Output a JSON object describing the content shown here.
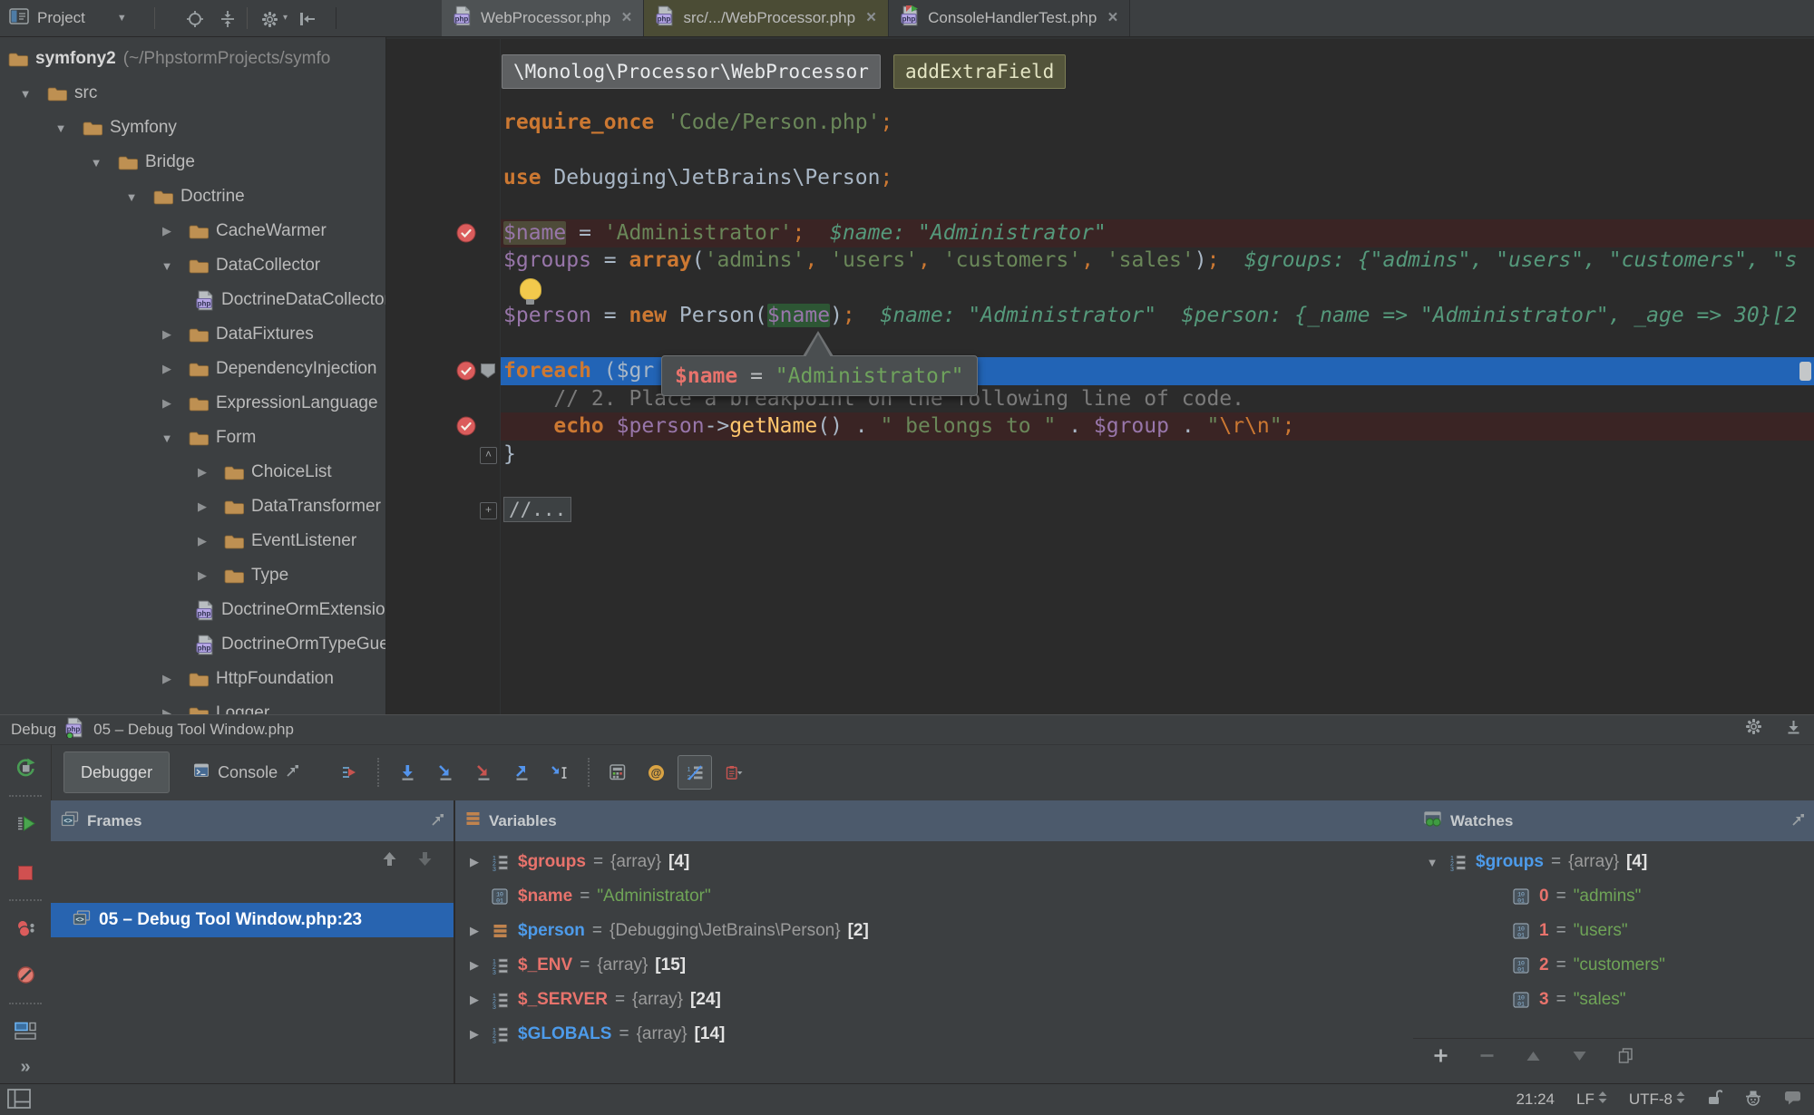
{
  "topbar": {
    "project_button": {
      "label": "Project"
    },
    "icons": [
      "scroll-from-source",
      "collapse-all",
      "settings",
      "hide-panel"
    ],
    "tabs": [
      {
        "label": "WebProcessor.php",
        "icon": "php-file",
        "state": "selected"
      },
      {
        "label": "src/.../WebProcessor.php",
        "icon": "php-file",
        "state": "library"
      },
      {
        "label": "ConsoleHandlerTest.php",
        "icon": "php-test-file",
        "state": "normal"
      }
    ]
  },
  "project_tree": {
    "root": {
      "name": "symfony2",
      "path": "(~/PhpstormProjects/symfo"
    },
    "items": [
      {
        "label": "src",
        "depth": 1,
        "type": "folder",
        "state": "expanded"
      },
      {
        "label": "Symfony",
        "depth": 2,
        "type": "folder",
        "state": "expanded"
      },
      {
        "label": "Bridge",
        "depth": 3,
        "type": "folder",
        "state": "expanded"
      },
      {
        "label": "Doctrine",
        "depth": 4,
        "type": "folder",
        "state": "expanded"
      },
      {
        "label": "CacheWarmer",
        "depth": 5,
        "type": "folder",
        "state": "collapsed"
      },
      {
        "label": "DataCollector",
        "depth": 5,
        "type": "folder",
        "state": "expanded"
      },
      {
        "label": "DoctrineDataCollector.php",
        "depth": 6,
        "type": "php-file"
      },
      {
        "label": "DataFixtures",
        "depth": 5,
        "type": "folder",
        "state": "collapsed"
      },
      {
        "label": "DependencyInjection",
        "depth": 5,
        "type": "folder",
        "state": "collapsed"
      },
      {
        "label": "ExpressionLanguage",
        "depth": 5,
        "type": "folder",
        "state": "collapsed"
      },
      {
        "label": "Form",
        "depth": 5,
        "type": "folder",
        "state": "expanded"
      },
      {
        "label": "ChoiceList",
        "depth": 6,
        "type": "folder",
        "state": "collapsed"
      },
      {
        "label": "DataTransformer",
        "depth": 6,
        "type": "folder",
        "state": "collapsed"
      },
      {
        "label": "EventListener",
        "depth": 6,
        "type": "folder",
        "state": "collapsed"
      },
      {
        "label": "Type",
        "depth": 6,
        "type": "folder",
        "state": "collapsed"
      },
      {
        "label": "DoctrineOrmExtension.php",
        "depth": 6,
        "type": "php-file"
      },
      {
        "label": "DoctrineOrmTypeGuesser.php",
        "depth": 6,
        "type": "php-file"
      },
      {
        "label": "HttpFoundation",
        "depth": 5,
        "type": "folder",
        "state": "collapsed"
      },
      {
        "label": "Logger",
        "depth": 5,
        "type": "folder",
        "state": "collapsed"
      }
    ]
  },
  "editor": {
    "breadcrumbs": [
      {
        "text": "\\Monolog\\Processor\\WebProcessor",
        "style": "class"
      },
      {
        "text": "addExtraField",
        "style": "method"
      }
    ],
    "tooltip": {
      "name": "$name",
      "eq": " = ",
      "value": "\"Administrator\""
    },
    "lines": [
      {
        "segs": []
      },
      {
        "segs": [
          [
            "kw",
            "require_once"
          ],
          [
            "pl",
            " "
          ],
          [
            "str",
            "'Code/Person.php'"
          ],
          [
            "sc",
            ";"
          ]
        ]
      },
      {
        "segs": []
      },
      {
        "segs": [
          [
            "kw",
            "use"
          ],
          [
            "pl",
            " Debugging\\JetBrains\\Person"
          ],
          [
            "sc",
            ";"
          ]
        ]
      },
      {
        "segs": []
      },
      {
        "bg": "bp",
        "gutter": "breakpoint",
        "segs": [
          [
            "var hlw",
            "$name"
          ],
          [
            "pl",
            " = "
          ],
          [
            "str",
            "'Administrator'"
          ],
          [
            "sc",
            ";"
          ],
          [
            "hint",
            "  $name: \"Administrator\""
          ]
        ]
      },
      {
        "segs": [
          [
            "var",
            "$groups"
          ],
          [
            "pl",
            " = "
          ],
          [
            "kw",
            "array"
          ],
          [
            "pl",
            "("
          ],
          [
            "str",
            "'admins'"
          ],
          [
            "sc",
            ","
          ],
          [
            "pl",
            " "
          ],
          [
            "str",
            "'users'"
          ],
          [
            "sc",
            ","
          ],
          [
            "pl",
            " "
          ],
          [
            "str",
            "'customers'"
          ],
          [
            "sc",
            ","
          ],
          [
            "pl",
            " "
          ],
          [
            "str",
            "'sales'"
          ],
          [
            "pl",
            ")"
          ],
          [
            "sc",
            ";"
          ],
          [
            "hint",
            "  $groups: {\"admins\", \"users\", \"customers\", \"s"
          ]
        ]
      },
      {
        "bulb": true,
        "segs": []
      },
      {
        "segs": [
          [
            "var",
            "$person"
          ],
          [
            "pl",
            " = "
          ],
          [
            "kw",
            "new"
          ],
          [
            "pl",
            " Person("
          ],
          [
            "var hle",
            "$name"
          ],
          [
            "pl",
            ")"
          ],
          [
            "sc",
            ";"
          ],
          [
            "hint",
            "  $name: \"Administrator\"  $person: {_name => \"Administrator\", _age => 30}[2"
          ]
        ]
      },
      {
        "segs": []
      },
      {
        "bg": "exec",
        "gutter": "breakpoint-exec",
        "marker": true,
        "segs": [
          [
            "kw",
            "foreach"
          ],
          [
            "pl",
            " ($gr"
          ]
        ]
      },
      {
        "segs": [
          [
            "cm",
            "    // 2. Place a breakpoint on the following line of code."
          ]
        ]
      },
      {
        "bg": "bp",
        "gutter": "breakpoint",
        "segs": [
          [
            "kw",
            "    echo"
          ],
          [
            "pl",
            " "
          ],
          [
            "var",
            "$person"
          ],
          [
            "pl",
            "->"
          ],
          [
            "fn",
            "getName"
          ],
          [
            "pl",
            "() . "
          ],
          [
            "str",
            "\" belongs to \""
          ],
          [
            "pl",
            " . "
          ],
          [
            "var",
            "$group"
          ],
          [
            "pl",
            " . "
          ],
          [
            "str",
            "\""
          ],
          [
            "esc",
            "\\r\\n"
          ],
          [
            "str",
            "\""
          ],
          [
            "sc",
            ";"
          ]
        ]
      },
      {
        "gutter": "fold-end",
        "segs": [
          [
            "pl",
            "}"
          ]
        ]
      },
      {
        "segs": []
      },
      {
        "gutter": "fold-collapsed",
        "segs": [
          [
            "fold",
            "//..."
          ]
        ]
      }
    ]
  },
  "debug": {
    "title": "Debug",
    "session": "05 – Debug Tool Window.php",
    "tabs": [
      {
        "label": "Debugger",
        "selected": true
      },
      {
        "label": "Console",
        "selected": false
      }
    ],
    "toolbar_icons": [
      "show-execution-point",
      "step-over",
      "step-into",
      "force-step-into",
      "step-out",
      "run-to-cursor",
      "evaluate-expression",
      "quick-evaluate",
      "inline-values",
      "dump-threads"
    ],
    "strip_icons": [
      "rerun",
      "resume",
      "stop",
      "view-breakpoints",
      "mute-breakpoints",
      "restore-layout",
      "more"
    ],
    "frames": {
      "title": "Frames",
      "toolbar": [
        "frame-up",
        "frame-down"
      ],
      "rows": [
        {
          "label": "05 – Debug Tool Window.php:23",
          "selected": true
        }
      ]
    },
    "variables": {
      "title": "Variables",
      "rows": [
        {
          "expand": "collapsed",
          "icon": "array",
          "name": "$groups",
          "name_color": "salmon",
          "value": "{array}",
          "count": "[4]"
        },
        {
          "expand": "none",
          "icon": "primitive",
          "name": "$name",
          "name_color": "salmon",
          "string": "\"Administrator\""
        },
        {
          "expand": "collapsed",
          "icon": "object",
          "name": "$person",
          "name_color": "blue",
          "value": "{Debugging\\JetBrains\\Person}",
          "count": "[2]"
        },
        {
          "expand": "collapsed",
          "icon": "array",
          "name": "$_ENV",
          "name_color": "salmon",
          "value": "{array}",
          "count": "[15]"
        },
        {
          "expand": "collapsed",
          "icon": "array",
          "name": "$_SERVER",
          "name_color": "salmon",
          "value": "{array}",
          "count": "[24]"
        },
        {
          "expand": "collapsed",
          "icon": "array",
          "name": "$GLOBALS",
          "name_color": "blue",
          "value": "{array}",
          "count": "[14]"
        }
      ]
    },
    "watches": {
      "title": "Watches",
      "toolbar": [
        "add-watch",
        "remove-watch",
        "move-up",
        "move-down",
        "duplicate"
      ],
      "rows": [
        {
          "expand": "expanded",
          "icon": "array",
          "name": "$groups",
          "name_color": "blue",
          "value": "{array}",
          "count": "[4]"
        },
        {
          "child": true,
          "icon": "primitive",
          "name": "0",
          "name_color": "salmon",
          "string": "\"admins\""
        },
        {
          "child": true,
          "icon": "primitive",
          "name": "1",
          "name_color": "salmon",
          "string": "\"users\""
        },
        {
          "child": true,
          "icon": "primitive",
          "name": "2",
          "name_color": "salmon",
          "string": "\"customers\""
        },
        {
          "child": true,
          "icon": "primitive",
          "name": "3",
          "name_color": "salmon",
          "string": "\"sales\""
        }
      ]
    }
  },
  "statusbar": {
    "time": "21:24",
    "line_separator": "LF",
    "encoding": "UTF-8",
    "icons": [
      "unlocked",
      "inspections-profile",
      "event-log"
    ]
  },
  "colors": {
    "accent_blue": "#2264B6",
    "breakpoint_red": "#DB5C5C",
    "selection_blue": "#2864B0",
    "panel_header": "#4C5A6C",
    "library_tab": "#4B4C35"
  }
}
